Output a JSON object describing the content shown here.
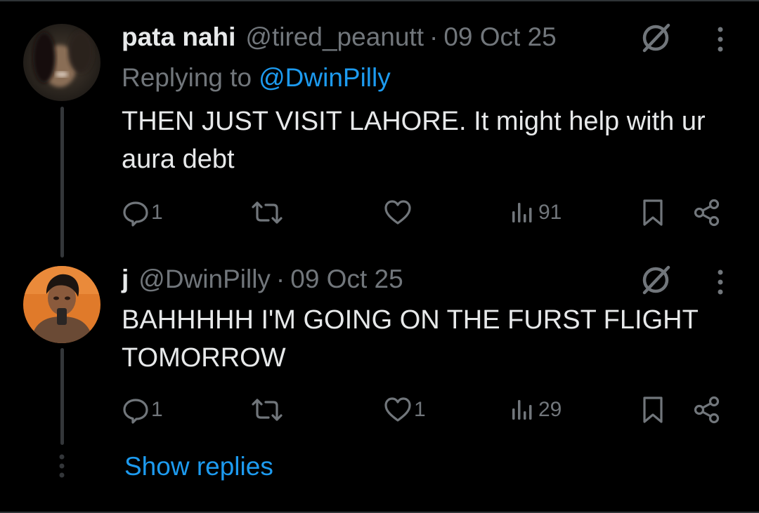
{
  "colors": {
    "background": "#000000",
    "text": "#e7e9ea",
    "muted": "#71767b",
    "accent": "#1d9bf0",
    "line": "#333639"
  },
  "posts": [
    {
      "display_name": "pata nahi",
      "handle": "@tired_peanutt",
      "separator": "·",
      "date": "09 Oct 25",
      "replying_prefix": "Replying to",
      "replying_to": "@DwinPilly",
      "text": "THEN JUST VISIT LAHORE. It might help with ur aura debt",
      "actions": {
        "replies": "1",
        "reposts": "",
        "likes": "",
        "views": "91"
      },
      "icons": [
        "grok-icon",
        "more-vertical-icon",
        "reply-icon",
        "repost-icon",
        "like-icon",
        "views-icon",
        "bookmark-icon",
        "share-icon"
      ]
    },
    {
      "display_name": "j",
      "handle": "@DwinPilly",
      "separator": "·",
      "date": "09 Oct 25",
      "text": "BAHHHHH I'M GOING ON THE FURST FLIGHT TOMORROW",
      "actions": {
        "replies": "1",
        "reposts": "",
        "likes": "1",
        "views": "29"
      },
      "icons": [
        "grok-icon",
        "more-vertical-icon",
        "reply-icon",
        "repost-icon",
        "like-icon",
        "views-icon",
        "bookmark-icon",
        "share-icon"
      ]
    }
  ],
  "footer": {
    "show_replies": "Show replies"
  }
}
